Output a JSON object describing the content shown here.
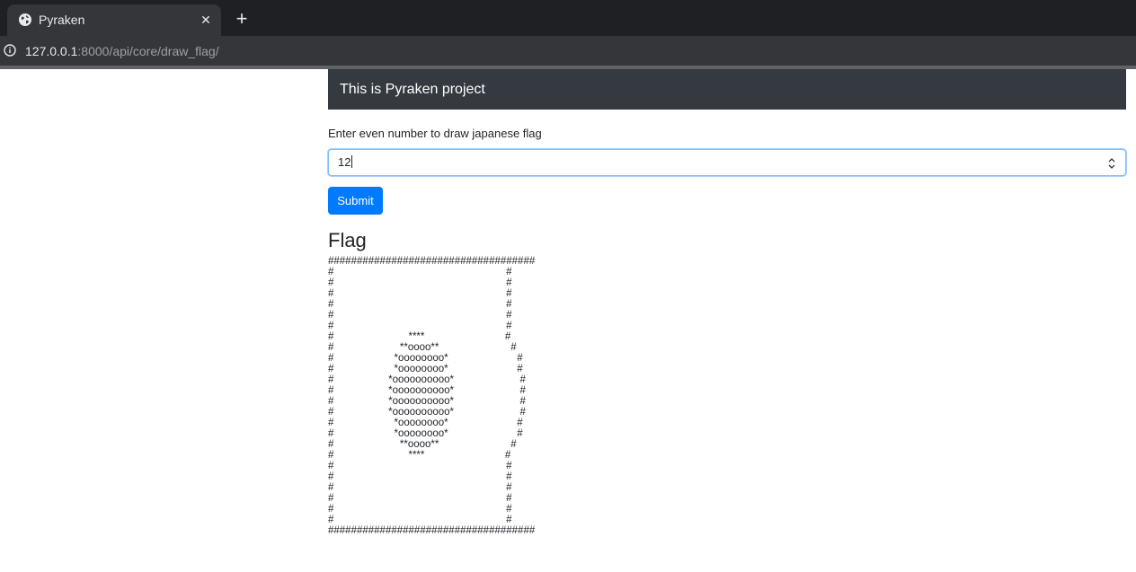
{
  "browser": {
    "tab_title": "Pyraken",
    "tab_close_glyph": "✕",
    "new_tab_glyph": "+",
    "url_host": "127.0.0.1",
    "url_rest": ":8000/api/core/draw_flag/"
  },
  "navbar": {
    "title": "This is Pyraken project"
  },
  "form": {
    "label": "Enter even number to draw japanese flag",
    "number_value": "12",
    "submit_label": "Submit"
  },
  "flag": {
    "heading": "Flag",
    "ascii_art": "####################################\n#                                                            #\n#                                                            #\n#                                                            #\n#                                                            #\n#                                                            #\n#                                                            #\n#                          ****                            #\n#                       **oooo**                         #\n#                     *oooooooo*                        #\n#                     *oooooooo*                        #\n#                   *oooooooooo*                       #\n#                   *oooooooooo*                       #\n#                   *oooooooooo*                       #\n#                   *oooooooooo*                       #\n#                     *oooooooo*                        #\n#                     *oooooooo*                        #\n#                       **oooo**                         #\n#                          ****                            #\n#                                                            #\n#                                                            #\n#                                                            #\n#                                                            #\n#                                                            #\n#                                                            #\n####################################"
  },
  "colors": {
    "navbar_bg": "#343a40",
    "button_bg": "#007bff",
    "focus_border": "#80bdff"
  }
}
